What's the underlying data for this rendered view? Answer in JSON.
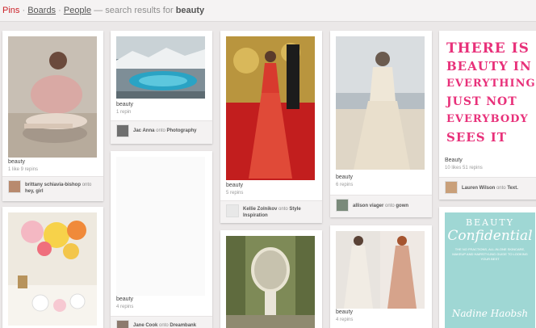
{
  "nav": {
    "pins": "Pins",
    "sep1": "·",
    "boards": "Boards",
    "sep2": "·",
    "people": "People",
    "dash": "—",
    "results_prefix": "search results for",
    "query": "beauty"
  },
  "pins": [
    {
      "desc": "beauty",
      "stats": "1 like  9 repins",
      "user": "brittany schiavia-bishop",
      "onto": "onto",
      "board": "hey, girl"
    },
    {
      "desc": "beauty",
      "stats": "1 repin",
      "user": "Jac Anna",
      "onto": "onto",
      "board": "Photography"
    },
    {
      "desc": "beauty",
      "stats": "5 repins",
      "user": "Kellie Zolnikov",
      "onto": "onto",
      "board": "Style Inspiration"
    },
    {
      "desc": "beauty",
      "stats": "6 repins",
      "user": "allison viager",
      "onto": "onto",
      "board": "gown"
    },
    {
      "desc": "Beauty",
      "stats": "10 likes  51 repins",
      "user": "Lauren Wilson",
      "onto": "onto",
      "board": "Text."
    },
    {
      "desc": "beauty",
      "stats": "4 repins",
      "user": "Jane Cook",
      "onto": "onto",
      "board": "Dreambank"
    },
    {
      "desc": "beauty",
      "stats": "4 repins"
    }
  ],
  "artwork": {
    "quote_lines": [
      "THERE IS",
      "BEAUTY IN",
      "EVERYTHING",
      "JUST NOT",
      "EVERYBODY",
      "SEES IT"
    ],
    "book_title_1": "BEAUTY",
    "book_title_2": "Confidential",
    "book_sub": "THE NO FRACTIONS, ALL-IN-ONE SKINCARE, MAKEUP AND HAIRSTYLING GUIDE TO LOOKING YOUR BEST",
    "book_author": "Nadine Haobsh"
  },
  "colors": {
    "accent": "#cb2027",
    "quote_pink": "#e8317a",
    "book_teal": "#9fd7d4"
  }
}
